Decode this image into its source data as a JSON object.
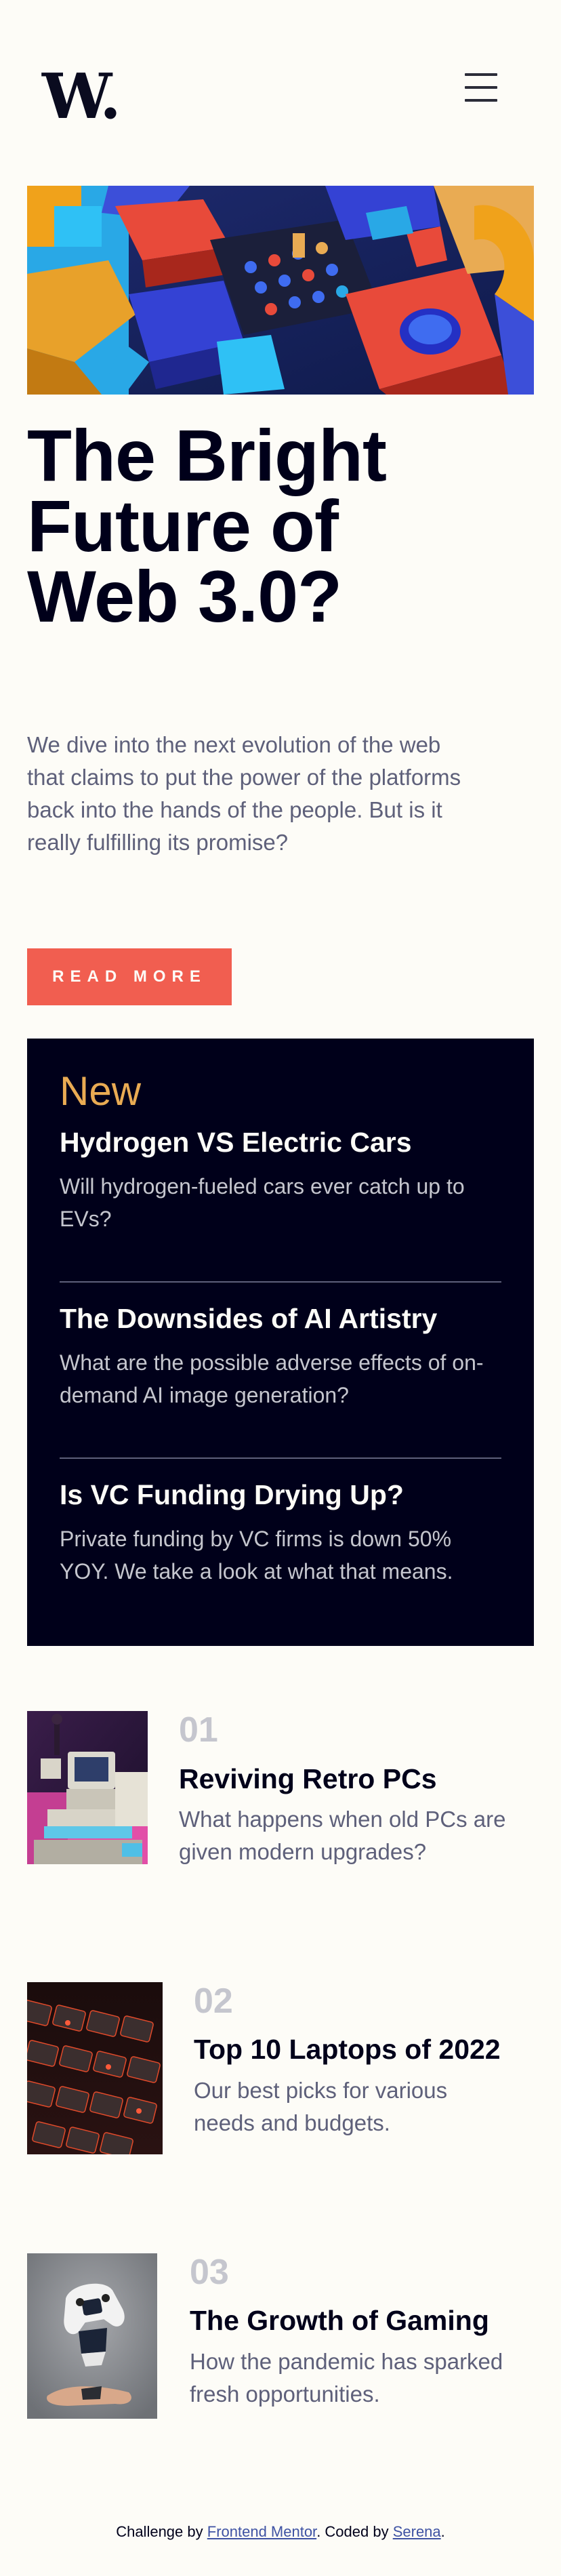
{
  "header": {
    "logo": "W.",
    "menu_icon": "hamburger-menu-icon"
  },
  "hero": {
    "image_icon": "abstract-3d-blocks-image",
    "title_line1": "The Bright",
    "title_line2": "Future of",
    "title_line3": "Web 3.0?",
    "description": "We dive into the next evolution of the web that claims to put the power of the platforms back into the hands of the people. But is it really fulfilling its promise?",
    "button_label": "READ MORE"
  },
  "new_panel": {
    "heading": "New",
    "items": [
      {
        "title": "Hydrogen VS Electric Cars",
        "text": "Will hydrogen-fueled cars ever catch up to EVs?"
      },
      {
        "title": "The Downsides of AI Artistry",
        "text": "What are the possible adverse effects of on-demand AI image generation?"
      },
      {
        "title": "Is VC Funding Drying Up?",
        "text": "Private funding by VC firms is down 50% YOY. We take a look at what that means."
      }
    ]
  },
  "articles": [
    {
      "number": "01",
      "title": "Reviving Retro PCs",
      "text": "What happens when old PCs are given modern upgrades?",
      "image_icon": "retro-pcs-image"
    },
    {
      "number": "02",
      "title": "Top 10 Laptops of 2022",
      "text": "Our best picks for various needs and budgets.",
      "image_icon": "laptop-keyboard-image"
    },
    {
      "number": "03",
      "title": "The Growth of Gaming",
      "text": "How the pandemic has sparked fresh opportunities.",
      "image_icon": "gaming-controller-image"
    }
  ],
  "footer": {
    "prefix": "Challenge by ",
    "link1": "Frontend Mentor",
    "middle": ". Coded by ",
    "link2": "Serena",
    "suffix": "."
  },
  "colors": {
    "background": "#fdfcf7",
    "dark_navy": "#00001a",
    "accent_red": "#f15e50",
    "accent_yellow": "#e9ab53",
    "grayish_blue": "#5e607a",
    "light_gray": "#c5c6ce"
  }
}
